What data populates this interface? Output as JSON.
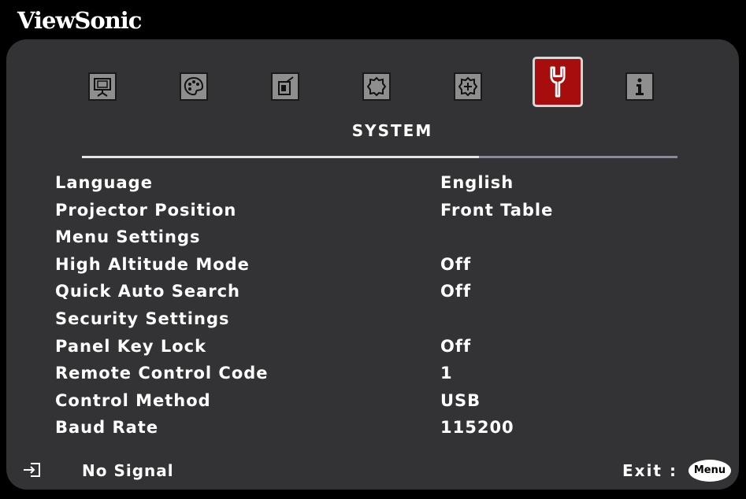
{
  "brand": "ViewSonic",
  "menu": {
    "tabs": [
      {
        "icon": "display-icon",
        "active": false
      },
      {
        "icon": "palette-icon",
        "active": false
      },
      {
        "icon": "input-source-icon",
        "active": false
      },
      {
        "icon": "settings-gear-icon",
        "active": false
      },
      {
        "icon": "advanced-gear-icon",
        "active": false
      },
      {
        "icon": "wrench-icon",
        "active": true
      },
      {
        "icon": "info-icon",
        "active": false
      }
    ],
    "active_section": "SYSTEM",
    "items": [
      {
        "label": "Language",
        "value": "English"
      },
      {
        "label": "Projector Position",
        "value": "Front Table"
      },
      {
        "label": "Menu Settings",
        "value": ""
      },
      {
        "label": "High Altitude Mode",
        "value": "Off"
      },
      {
        "label": "Quick Auto Search",
        "value": "Off"
      },
      {
        "label": "Security Settings",
        "value": ""
      },
      {
        "label": "Panel Key Lock",
        "value": "Off"
      },
      {
        "label": "Remote Control Code",
        "value": "1"
      },
      {
        "label": "Control Method",
        "value": "USB"
      },
      {
        "label": "Baud Rate",
        "value": "115200"
      }
    ]
  },
  "footer": {
    "signal_status": "No Signal",
    "exit_label": "Exit :",
    "menu_button": "Menu"
  },
  "colors": {
    "panel": "#333336",
    "active_tab": "#a80d0d",
    "text": "#ffffff"
  }
}
